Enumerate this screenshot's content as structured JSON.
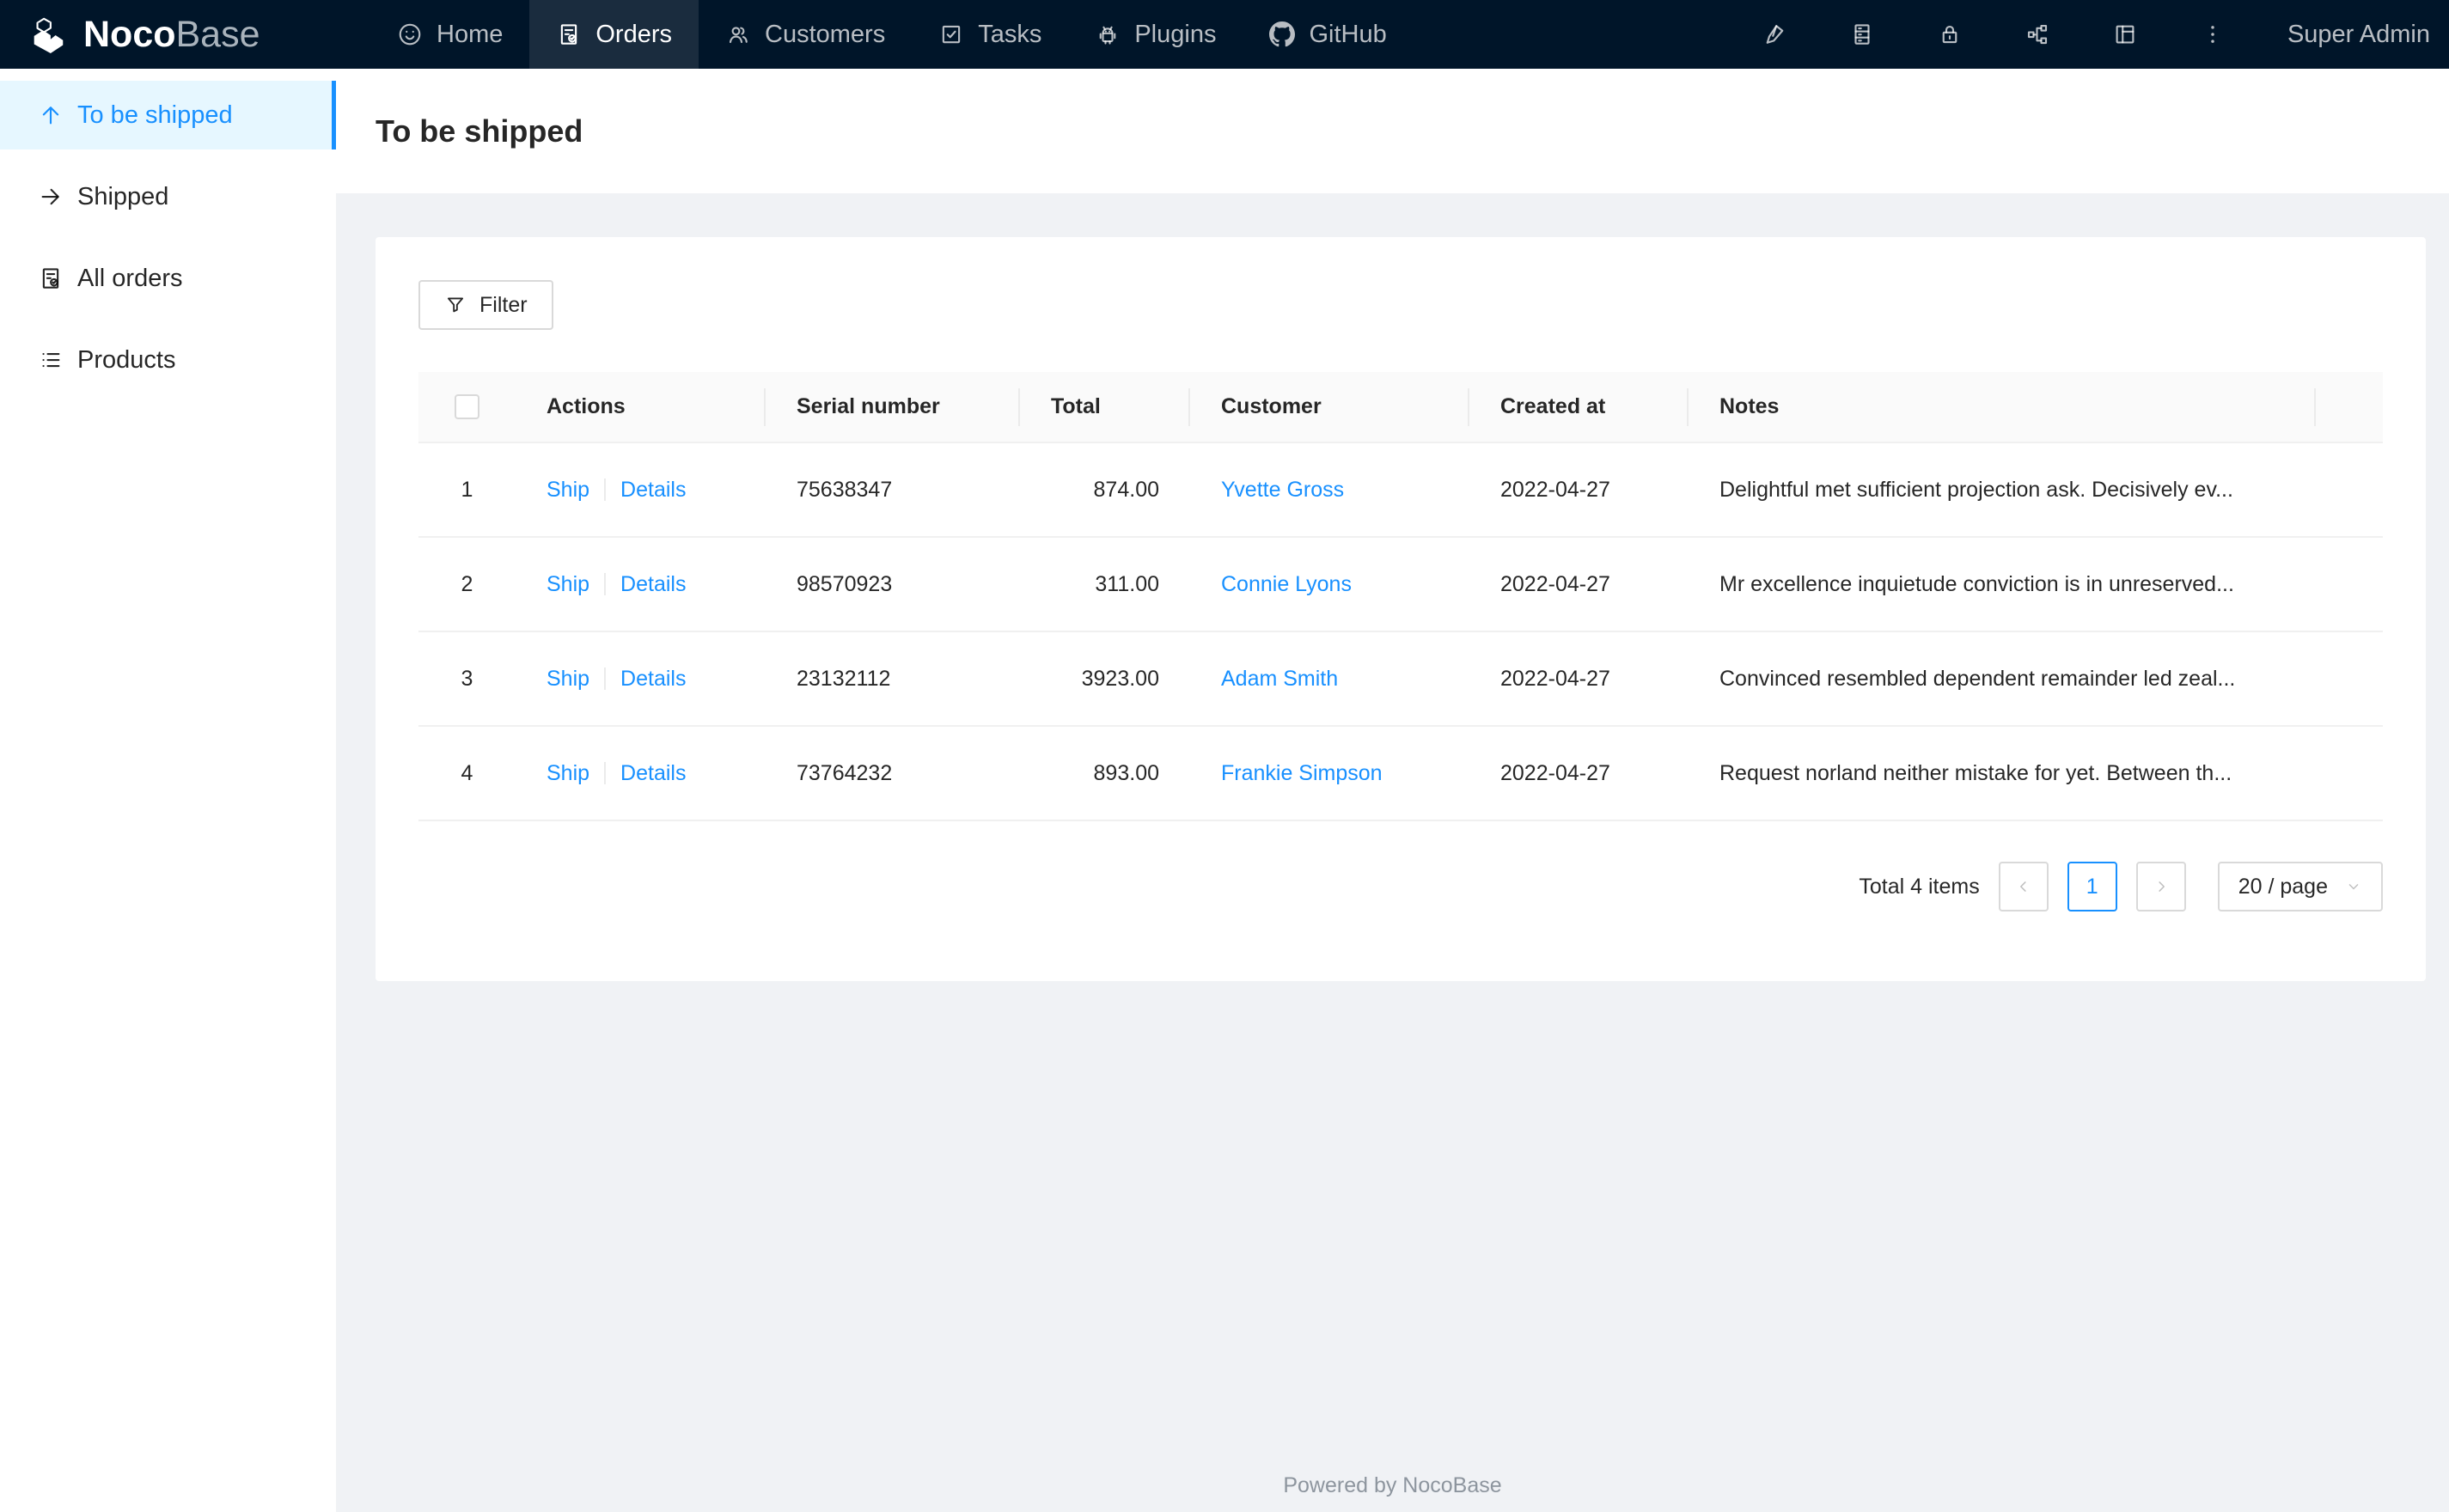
{
  "navbar": {
    "logo_bold": "Noco",
    "logo_light": "Base",
    "items": [
      {
        "label": "Home",
        "icon": "smile-icon",
        "active": false
      },
      {
        "label": "Orders",
        "icon": "file-done-icon",
        "active": true
      },
      {
        "label": "Customers",
        "icon": "team-icon",
        "active": false
      },
      {
        "label": "Tasks",
        "icon": "check-square-icon",
        "active": false
      },
      {
        "label": "Plugins",
        "icon": "android-icon",
        "active": false
      },
      {
        "label": "GitHub",
        "icon": "github-icon",
        "active": false
      }
    ],
    "right_icons": [
      "highlighter-icon",
      "database-icon",
      "lock-icon",
      "apartment-icon",
      "layout-icon",
      "ellipsis-icon"
    ],
    "user": "Super Admin"
  },
  "sidebar": {
    "items": [
      {
        "label": "To be shipped",
        "icon": "arrow-up-icon",
        "active": true
      },
      {
        "label": "Shipped",
        "icon": "arrow-right-icon",
        "active": false
      },
      {
        "label": "All orders",
        "icon": "file-done-icon",
        "active": false
      },
      {
        "label": "Products",
        "icon": "list-icon",
        "active": false
      }
    ]
  },
  "page": {
    "title": "To be shipped"
  },
  "toolbar": {
    "filter_label": "Filter"
  },
  "table": {
    "columns": [
      "",
      "Actions",
      "Serial number",
      "Total",
      "Customer",
      "Created at",
      "Notes"
    ],
    "action_labels": {
      "ship": "Ship",
      "details": "Details"
    },
    "rows": [
      {
        "index": "1",
        "serial": "75638347",
        "total": "874.00",
        "customer": "Yvette Gross",
        "created_at": "2022-04-27",
        "notes": "Delightful met sufficient projection ask. Decisively ev..."
      },
      {
        "index": "2",
        "serial": "98570923",
        "total": "311.00",
        "customer": "Connie Lyons",
        "created_at": "2022-04-27",
        "notes": "Mr excellence inquietude conviction is in unreserved..."
      },
      {
        "index": "3",
        "serial": "23132112",
        "total": "3923.00",
        "customer": "Adam Smith",
        "created_at": "2022-04-27",
        "notes": "Convinced resembled dependent remainder led zeal..."
      },
      {
        "index": "4",
        "serial": "73764232",
        "total": "893.00",
        "customer": "Frankie Simpson",
        "created_at": "2022-04-27",
        "notes": "Request norland neither mistake for yet. Between th..."
      }
    ]
  },
  "pagination": {
    "total_text": "Total 4 items",
    "current_page": "1",
    "page_size": "20 / page"
  },
  "footer": {
    "text": "Powered by NocoBase"
  },
  "colors": {
    "accent": "#1890ff",
    "nav_bg": "#001529",
    "content_bg": "#f0f2f5",
    "active_menu_bg": "#e6f7ff"
  }
}
